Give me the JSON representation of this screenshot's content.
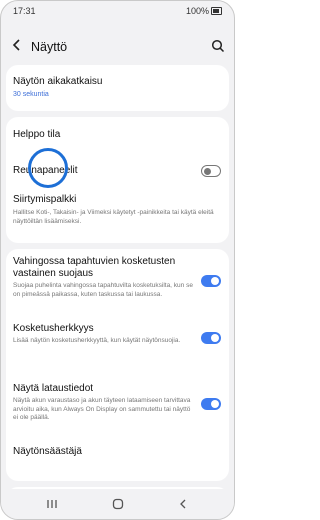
{
  "status": {
    "time": "17:31",
    "battery": "100%"
  },
  "appbar": {
    "title": "Näyttö"
  },
  "screen_timeout": {
    "label": "Näytön aikakatkaisu",
    "value": "30 sekuntia"
  },
  "section2": {
    "easy_mode": "Helppo tila",
    "edge_panels": "Reunapaneelit",
    "edge_panels_on": false,
    "navbar": {
      "label": "Siirtymispalkki",
      "desc": "Hallitse Koti-, Takaisin- ja Viimeksi käytetyt -painikkeita tai käytä eleitä näyttöiltän lisäämiseksi."
    }
  },
  "section3": {
    "accidental": {
      "label": "Vahingossa tapahtuvien kosketusten vastainen suojaus",
      "desc": "Suojaa puhelinta vahingossa tapahtuvilta kosketuksilta, kun se on pimeässä paikassa, kuten taskussa tai laukussa.",
      "on": true
    },
    "sensitivity": {
      "label": "Kosketusherkkyys",
      "desc": "Lisää näytön kosketusherkkyyttä, kun käytät näytönsuojia.",
      "on": true
    },
    "charging": {
      "label": "Näytä lataustiedot",
      "desc": "Näytä akun varaustaso ja akun täyteen lataamiseen tarvittava arvioitu aika, kun Always On Display on sammutettu tai näyttö ei ole päällä.",
      "on": true
    },
    "screensaver": {
      "label": "Näytönsäästäjä"
    }
  },
  "colors": {
    "accent": "#3e7bf0",
    "highlight_ring": "#1d6fd6"
  }
}
